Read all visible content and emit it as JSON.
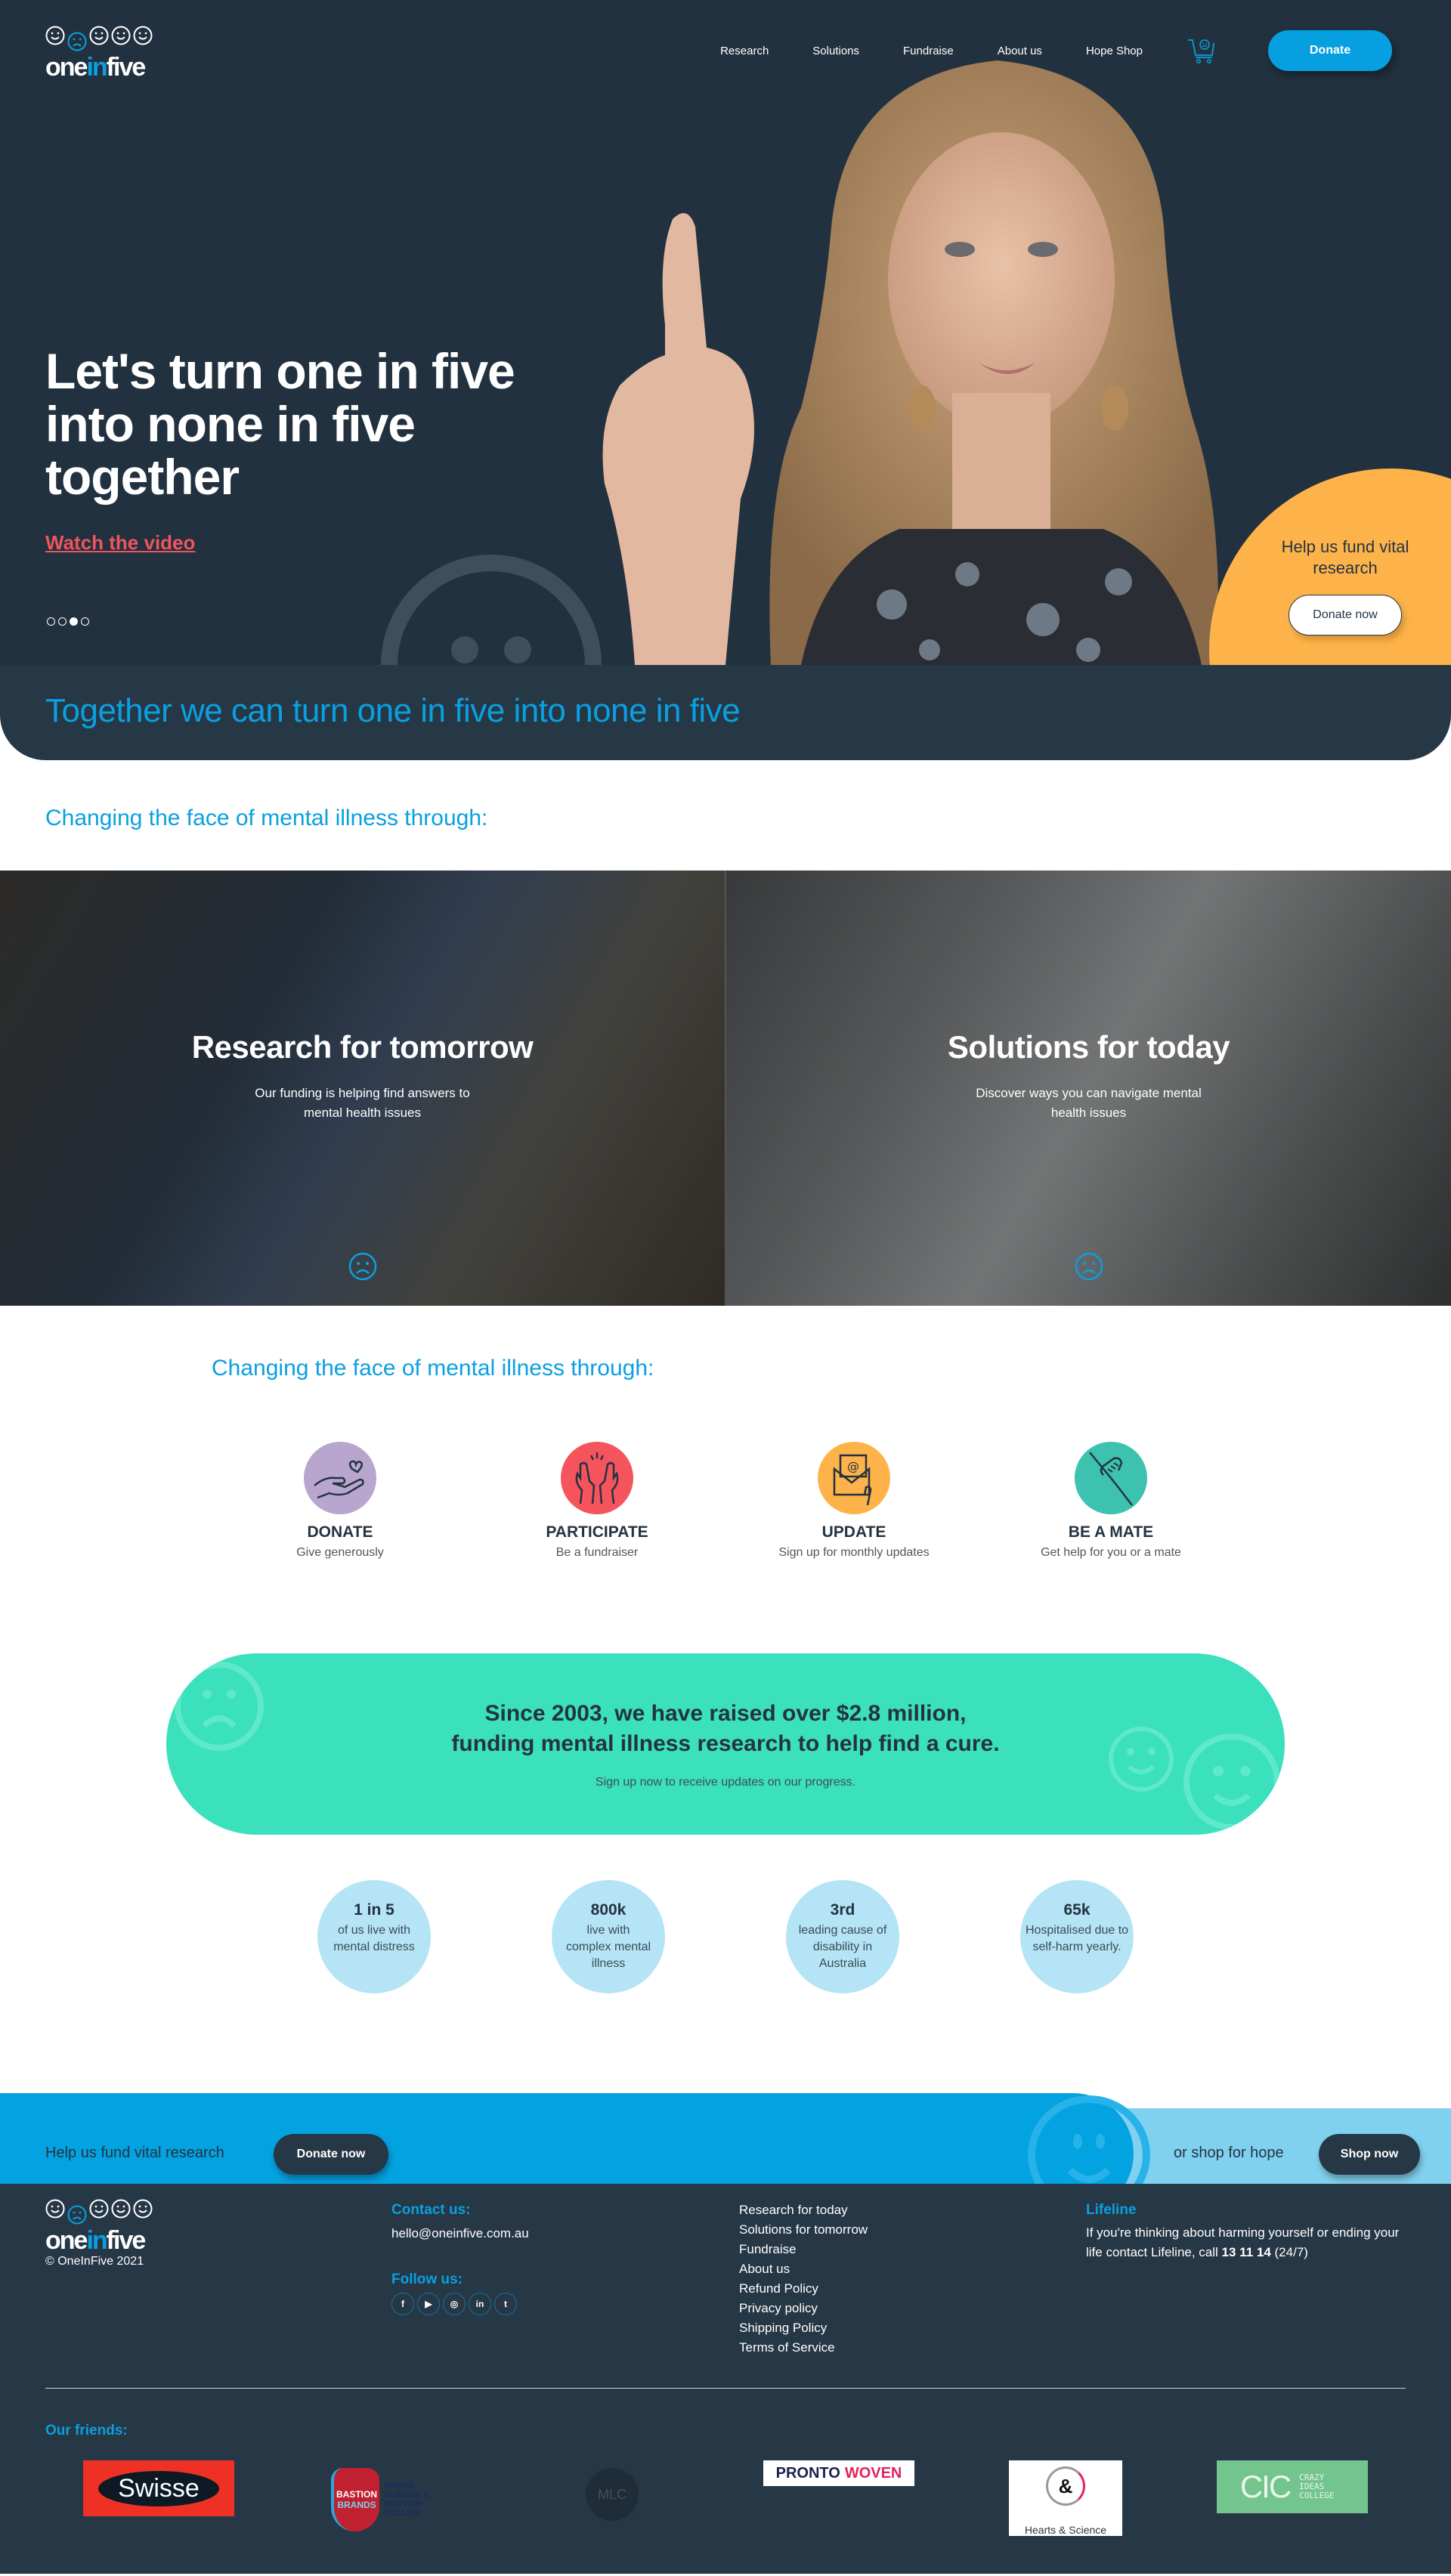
{
  "header": {
    "logo": {
      "word_one": "one",
      "word_in": "in",
      "word_five": "five"
    },
    "nav": [
      "Research",
      "Solutions",
      "Fundraise",
      "About us",
      "Hope Shop"
    ],
    "cart_icon": "shopping-cart-sad-face-icon",
    "donate_label": "Donate"
  },
  "hero": {
    "title": "Let's turn one in five into none in five together",
    "watch_label": "Watch the video",
    "slides": {
      "count": 4,
      "active_index": 2
    },
    "fund_text": "Help us fund vital research",
    "fund_button": "Donate now"
  },
  "band": {
    "title": "Together we can turn one in five into none in five"
  },
  "changing_heading": "Changing the face of mental illness through:",
  "cards": [
    {
      "title": "Research for tomorrow",
      "text": "Our funding is helping find answers to mental health issues",
      "icon": "sad-face-icon"
    },
    {
      "title": "Solutions for today",
      "text": "Discover ways you can navigate mental health issues",
      "icon": "sad-face-icon"
    }
  ],
  "changing_heading_2": "Changing the face of mental illness through:",
  "ways": [
    {
      "title": "DONATE",
      "text": "Give generously",
      "color": "#b8a6cf",
      "icon": "hand-heart-icon"
    },
    {
      "title": "PARTICIPATE",
      "text": "Be a fundraiser",
      "color": "#f6545c",
      "icon": "raised-hands-icon"
    },
    {
      "title": "UPDATE",
      "text": "Sign up for monthly updates",
      "color": "#fdb34a",
      "icon": "email-envelope-icon"
    },
    {
      "title": "BE A MATE",
      "text": "Get help for you or a mate",
      "color": "#3cc2ae",
      "icon": "helping-hand-icon"
    }
  ],
  "raised": {
    "line1": "Since 2003, we have raised over $2.8 million,",
    "line2": "funding mental illness research to help find a cure.",
    "subtext": "Sign up now to receive updates on our progress."
  },
  "stats": [
    {
      "num": "1 in 5",
      "desc": "of us live with mental distress"
    },
    {
      "num": "800k",
      "desc": "live with complex mental illness"
    },
    {
      "num": "3rd",
      "desc": "leading cause of disability in Australia"
    },
    {
      "num": "65k",
      "desc": "Hospitalised due to self-harm yearly."
    }
  ],
  "cta": {
    "left_text": "Help us fund vital research",
    "donate_label": "Donate now",
    "right_text": "or shop for hope",
    "shop_label": "Shop now"
  },
  "footer": {
    "copyright": "© OneInFive 2021",
    "contact_head": "Contact us:",
    "email": "hello@oneinfive.com.au",
    "follow_head": "Follow us:",
    "socials": [
      {
        "label": "f",
        "icon": "facebook-icon"
      },
      {
        "label": "▶",
        "icon": "youtube-icon"
      },
      {
        "label": "◎",
        "icon": "instagram-icon"
      },
      {
        "label": "in",
        "icon": "linkedin-icon"
      },
      {
        "label": "t",
        "icon": "twitter-icon"
      }
    ],
    "links": [
      "Research for today",
      "Solutions for tomorrow",
      "Fundraise",
      "About us",
      "Refund Policy",
      "Privacy policy",
      "Shipping Policy",
      "Terms of Service"
    ],
    "lifeline_head": "Lifeline",
    "lifeline_text": "If you're thinking about harming yourself or ending your life contact Lifeline, call ",
    "lifeline_number": "13 11 14",
    "lifeline_suffix": " (24/7)",
    "friends_head": "Our friends:",
    "friends": {
      "swisse": "Swisse",
      "bastion_1": "BASTION",
      "bastion_2": "BRANDS",
      "bastion_tag": "WHERE SCIENCE & EMOTION COLLIDE",
      "mlc": "MLC",
      "pronto_1": "PRONTO",
      "pronto_2": "WOVEN",
      "hearts_amp": "&",
      "hearts_caption": "Hearts & Science",
      "cic_big": "CIC",
      "cic_small": "CRAZY IDEAS COLLEGE"
    }
  },
  "colors": {
    "navy": "#22313f",
    "accent_blue": "#0aa0e0",
    "orange": "#fdb34a",
    "teal": "#3be0bd",
    "light_blue": "#b4e4f5",
    "watch_red": "#f0545c"
  }
}
